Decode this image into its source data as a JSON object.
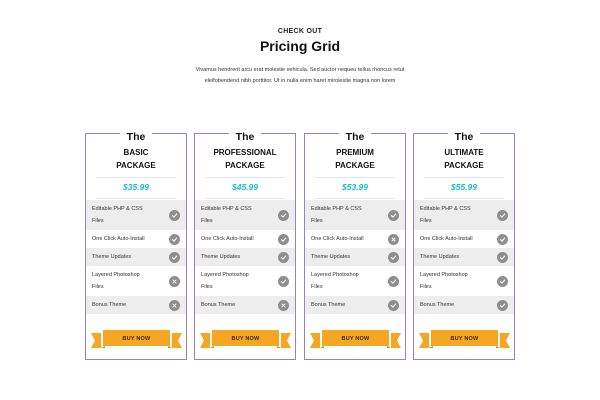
{
  "header": {
    "eyebrow": "CHECK OUT",
    "title": "Pricing Grid",
    "description": "Vivamus hendrerit arcu erat molestie vehicula. Sed auctor nequeu tellus rhoncus retut eleifobendend nibh porttitor. Ut in nulla enim haret mirolestie magna non lorem"
  },
  "colors": {
    "card_border": "#a07bc6",
    "price": "#1bbfbe",
    "ribbon": "#f5a623",
    "ribbon_dark": "#c9851a",
    "icon_bg": "#8e8e8e",
    "row_shade": "#ededed"
  },
  "cards": [
    {
      "top_label": "The",
      "name_line1": "BASIC",
      "name_line2": "PACKAGE",
      "price": "$35.99",
      "button": "BUY NOW",
      "features": [
        {
          "line1": "Editable PHP & CSS",
          "line2": "Files",
          "icon": "check-icon"
        },
        {
          "line1": "One Click Auto-Install",
          "line2": "",
          "icon": "check-icon"
        },
        {
          "line1": "Theme Updates",
          "line2": "",
          "icon": "check-icon"
        },
        {
          "line1": "Layered Photoshop",
          "line2": "Files",
          "icon": "cross-icon"
        },
        {
          "line1": "Bonus Theme",
          "line2": "",
          "icon": "cross-icon"
        }
      ]
    },
    {
      "top_label": "The",
      "name_line1": "PROFESSIONAL",
      "name_line2": "PACKAGE",
      "price": "$45.99",
      "button": "BUY NOW",
      "features": [
        {
          "line1": "Editable PHP & CSS",
          "line2": "Files",
          "icon": "check-icon"
        },
        {
          "line1": "One Click Auto-Install",
          "line2": "",
          "icon": "check-icon"
        },
        {
          "line1": "Theme Updates",
          "line2": "",
          "icon": "check-icon"
        },
        {
          "line1": "Layered Photoshop",
          "line2": "Files",
          "icon": "check-icon"
        },
        {
          "line1": "Bonus Theme",
          "line2": "",
          "icon": "cross-icon"
        }
      ]
    },
    {
      "top_label": "The",
      "name_line1": "PREMIUM",
      "name_line2": "PACKAGE",
      "price": "$53.99",
      "button": "BUY NOW",
      "features": [
        {
          "line1": "Editable PHP & CSS",
          "line2": "Files",
          "icon": "check-icon"
        },
        {
          "line1": "One Click Auto-Install",
          "line2": "",
          "icon": "cross-icon"
        },
        {
          "line1": "Theme Updates",
          "line2": "",
          "icon": "check-icon"
        },
        {
          "line1": "Layered Photoshop",
          "line2": "Files",
          "icon": "check-icon"
        },
        {
          "line1": "Bonus Theme",
          "line2": "",
          "icon": "check-icon"
        }
      ]
    },
    {
      "top_label": "The",
      "name_line1": "ULTIMATE",
      "name_line2": "PACKAGE",
      "price": "$55.99",
      "button": "BUY NOW",
      "features": [
        {
          "line1": "Editable PHP & CSS",
          "line2": "Files",
          "icon": "check-icon"
        },
        {
          "line1": "One Click Auto-Install",
          "line2": "",
          "icon": "check-icon"
        },
        {
          "line1": "Theme Updates",
          "line2": "",
          "icon": "check-icon"
        },
        {
          "line1": "Layered Photoshop",
          "line2": "Files",
          "icon": "check-icon"
        },
        {
          "line1": "Bonus Theme",
          "line2": "",
          "icon": "check-icon"
        }
      ]
    }
  ]
}
